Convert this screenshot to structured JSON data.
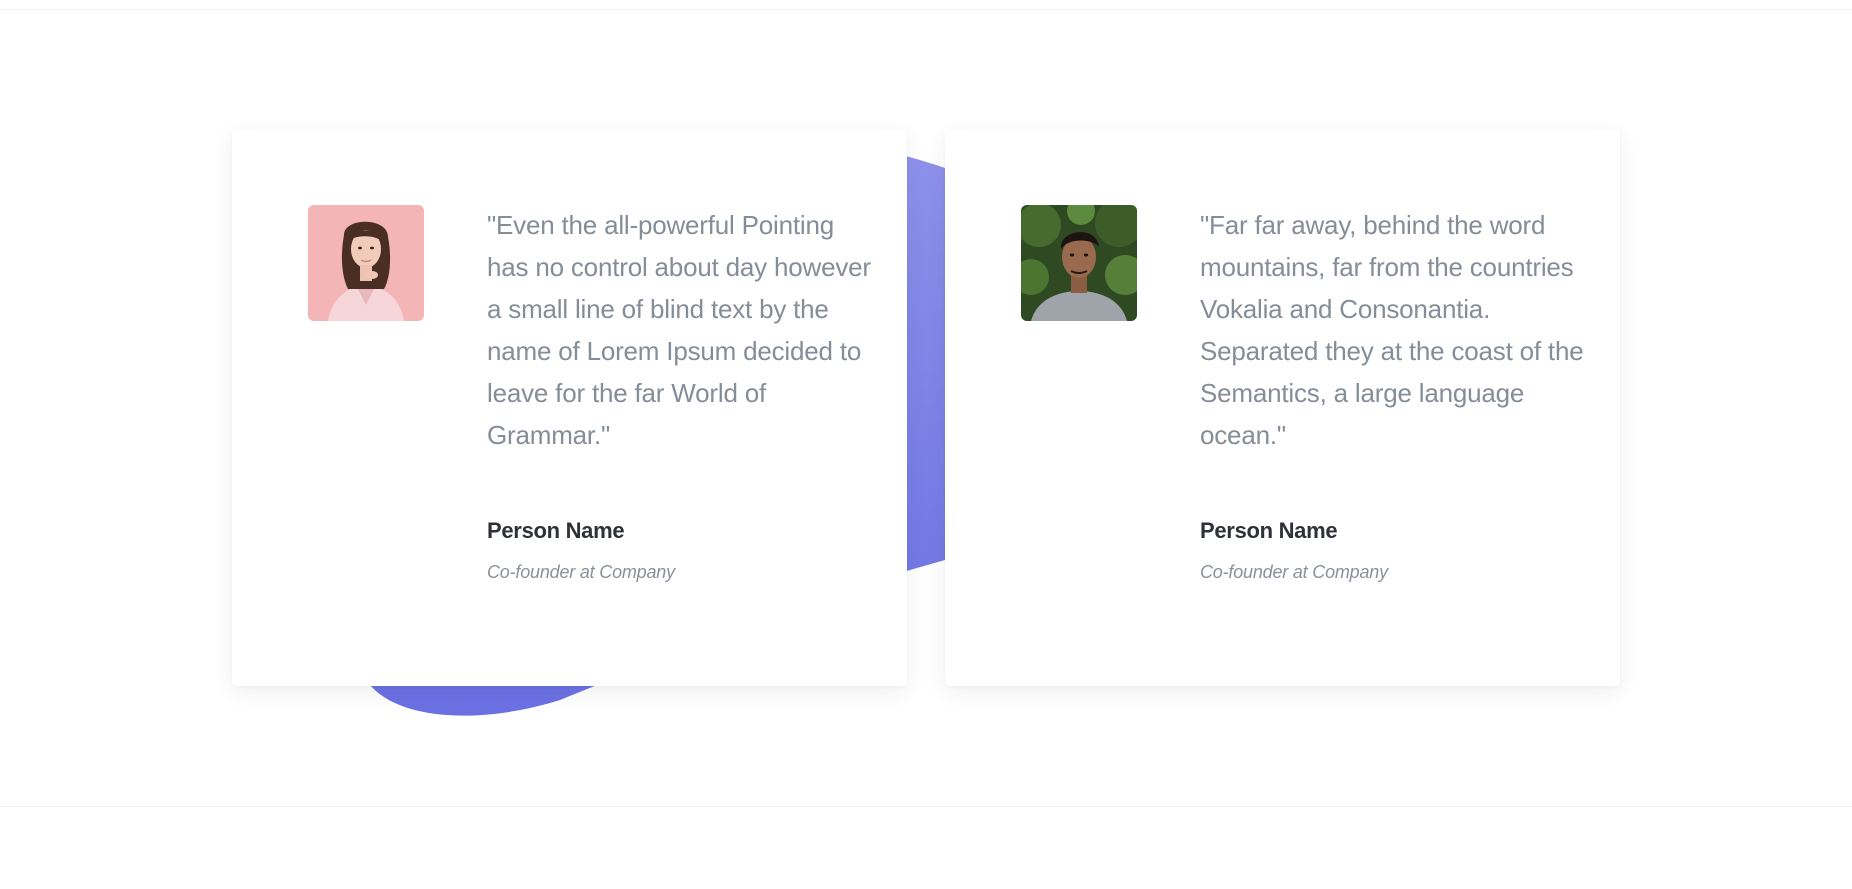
{
  "theme": {
    "accent": "#6f74e2",
    "quote_color": "#858d98",
    "name_color": "#2e3136",
    "role_color": "#8a919b"
  },
  "testimonials": [
    {
      "avatar_icon": "woman-portrait-photo",
      "quote": "\"Even the all-powerful Pointing has no control about day however a small line of blind text by the name of Lorem Ipsum decided to leave for the far World of Grammar.\"",
      "name": "Person Name",
      "role": "Co-founder at Company"
    },
    {
      "avatar_icon": "man-portrait-photo",
      "quote": "\"Far far away, behind the word mountains, far from the countries Vokalia and Consonantia. Separated they at the coast of the Semantics, a large language ocean.\"",
      "name": "Person Name",
      "role": "Co-founder at Company"
    }
  ]
}
